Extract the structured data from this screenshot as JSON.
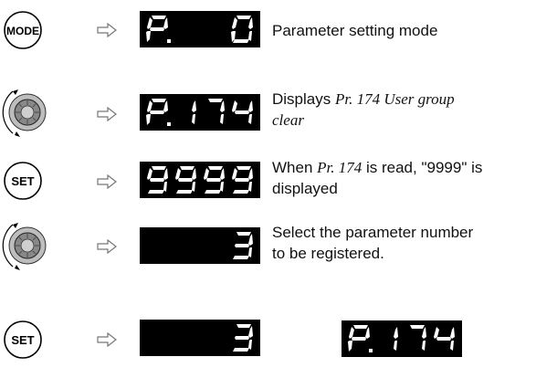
{
  "steps": [
    {
      "button": "MODE",
      "display": [
        "P",
        ".",
        "",
        "",
        "0"
      ],
      "text": "Parameter setting mode"
    },
    {
      "button": "dial",
      "display": [
        "P",
        ".",
        "1",
        "7",
        "4"
      ],
      "text_a": "Displays ",
      "text_b": "Pr. 174  User group",
      "text_c": "clear"
    },
    {
      "button": "SET",
      "display": [
        "9",
        "9",
        "9",
        "9"
      ],
      "text_a": "When ",
      "text_b": "Pr. 174",
      "text_c": " is read, \"9999\" is",
      "text_d": "displayed"
    },
    {
      "button": "dial",
      "display": [
        "",
        "",
        "",
        "3"
      ],
      "text": "Select the parameter number",
      "text2": "to be registered."
    },
    {
      "button": "SET",
      "display": [
        "",
        "",
        "",
        "3"
      ],
      "display2": [
        "P",
        ".",
        "1",
        "7",
        "4"
      ]
    }
  ],
  "labels": {
    "mode": "MODE",
    "set": "SET"
  }
}
